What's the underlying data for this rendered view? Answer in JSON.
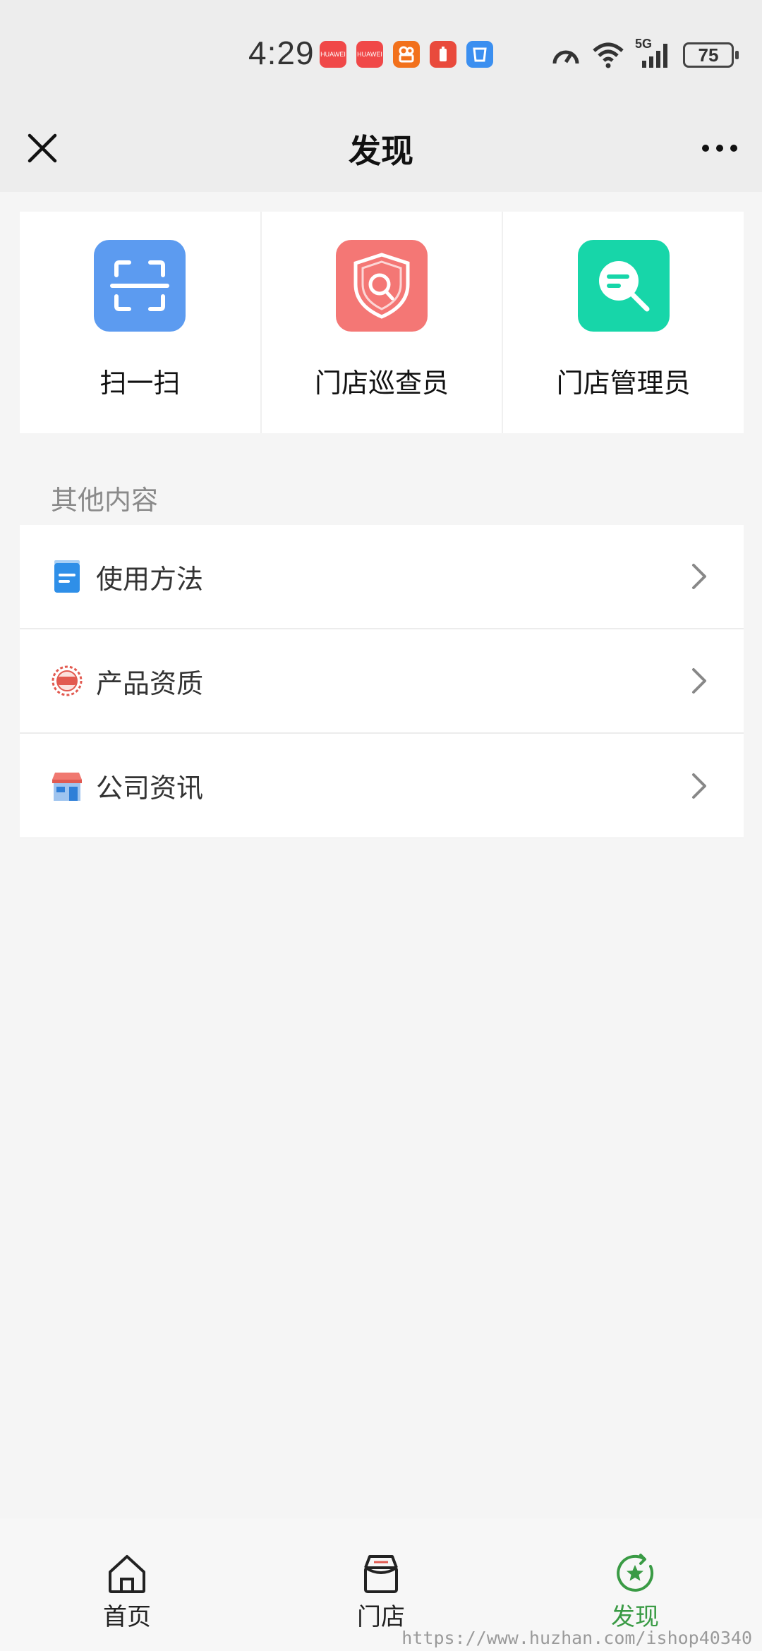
{
  "status_bar": {
    "time": "4:29",
    "network": "5G",
    "battery": "75",
    "app_icons": [
      {
        "name": "huawei-app-icon",
        "color": "#f04848",
        "text": "HUAWEI"
      },
      {
        "name": "huawei-app-icon",
        "color": "#f04848",
        "text": "HUAWEI"
      },
      {
        "name": "video-app-icon",
        "color": "#f2711c",
        "text": ""
      },
      {
        "name": "battery-app-icon",
        "color": "#f04848",
        "text": ""
      },
      {
        "name": "cup-app-icon",
        "color": "#3b8ff0",
        "text": ""
      }
    ]
  },
  "navbar": {
    "title": "发现",
    "close_icon": "close-icon",
    "more_icon": "more-icon"
  },
  "quick_actions": [
    {
      "label": "扫一扫",
      "icon": "scan-icon",
      "color": "#5c9bf0"
    },
    {
      "label": "门店巡查员",
      "icon": "shield-search-icon",
      "color": "#f47775"
    },
    {
      "label": "门店管理员",
      "icon": "search-list-icon",
      "color": "#17d6a9"
    }
  ],
  "section": {
    "title": "其他内容",
    "items": [
      {
        "label": "使用方法",
        "icon": "document-icon"
      },
      {
        "label": "产品资质",
        "icon": "seal-icon"
      },
      {
        "label": "公司资讯",
        "icon": "store-icon"
      }
    ]
  },
  "tabbar": {
    "tabs": [
      {
        "label": "首页",
        "icon": "home-icon",
        "active": false
      },
      {
        "label": "门店",
        "icon": "shop-icon",
        "active": false
      },
      {
        "label": "发现",
        "icon": "discover-icon",
        "active": true
      }
    ],
    "active_color": "#3a9b45"
  },
  "watermark": "https://www.huzhan.com/ishop40340"
}
